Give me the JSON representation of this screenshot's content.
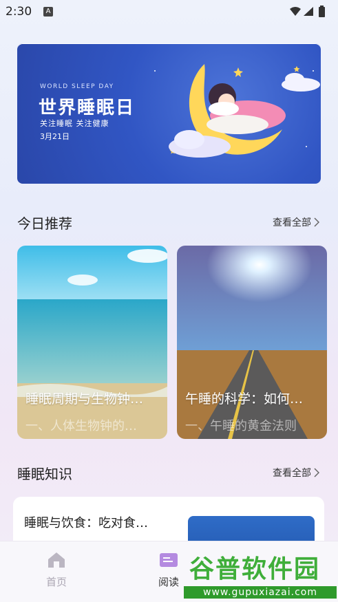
{
  "status": {
    "time": "2:30",
    "a_icon": "A"
  },
  "banner": {
    "en": "WORLD SLEEP DAY",
    "title": "世界睡眠日",
    "sub": "关注睡眠 关注健康",
    "date": "3月21日",
    "art_icon": "moon-girl-sleeping"
  },
  "today": {
    "title": "今日推荐",
    "see_all": "查看全部",
    "cards": [
      {
        "title": "睡眠周期与生物钟…",
        "sub": "一、人体生物钟的…"
      },
      {
        "title": "午睡的科学：如何…",
        "sub": "一、午睡的黄金法则"
      }
    ]
  },
  "knowledge": {
    "title": "睡眠知识",
    "see_all": "查看全部",
    "card": {
      "title": "睡眠与饮食：吃对食…"
    }
  },
  "nav": {
    "home": "首页",
    "read": "阅读"
  },
  "watermark": {
    "cn": "谷普软件园",
    "url": "www.gupuxiazai.com"
  },
  "colors": {
    "accent": "#a87ad8",
    "banner_blue": "#3156c4",
    "watermark_green": "#3fae3a"
  }
}
